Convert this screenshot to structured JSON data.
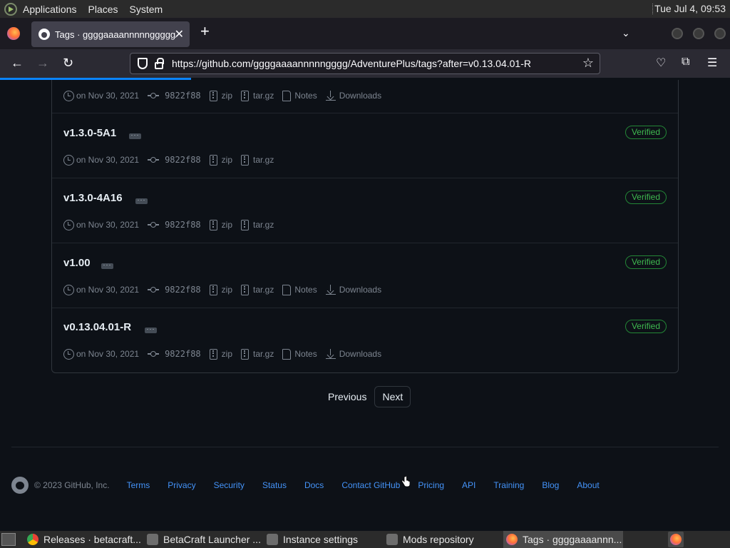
{
  "top_panel": {
    "menus": [
      "Applications",
      "Places",
      "System"
    ],
    "clock": "Tue Jul  4, 09:53"
  },
  "browser": {
    "tab_title": "Tags · ggggaaaannnnnggggg/AdventurePlus",
    "url": "https://github.com/ggggaaaannnnngggg/AdventurePlus/tags?after=v0.13.04.01-R"
  },
  "tags": [
    {
      "name": "",
      "verified": "",
      "date": "on Nov 30, 2021",
      "commit": "9822f88",
      "zip": "zip",
      "targz": "tar.gz",
      "notes": "Notes",
      "downloads": "Downloads"
    },
    {
      "name": "v1.3.0-5A1",
      "verified": "Verified",
      "date": "on Nov 30, 2021",
      "commit": "9822f88",
      "zip": "zip",
      "targz": "tar.gz",
      "notes": "",
      "downloads": ""
    },
    {
      "name": "v1.3.0-4A16",
      "verified": "Verified",
      "date": "on Nov 30, 2021",
      "commit": "9822f88",
      "zip": "zip",
      "targz": "tar.gz",
      "notes": "",
      "downloads": ""
    },
    {
      "name": "v1.00",
      "verified": "Verified",
      "date": "on Nov 30, 2021",
      "commit": "9822f88",
      "zip": "zip",
      "targz": "tar.gz",
      "notes": "Notes",
      "downloads": "Downloads"
    },
    {
      "name": "v0.13.04.01-R",
      "verified": "Verified",
      "date": "on Nov 30, 2021",
      "commit": "9822f88",
      "zip": "zip",
      "targz": "tar.gz",
      "notes": "Notes",
      "downloads": "Downloads"
    }
  ],
  "pagination": {
    "previous": "Previous",
    "next": "Next"
  },
  "footer": {
    "copyright": "© 2023 GitHub, Inc.",
    "links": [
      "Terms",
      "Privacy",
      "Security",
      "Status",
      "Docs",
      "Contact GitHub",
      "Pricing",
      "API",
      "Training",
      "Blog",
      "About"
    ]
  },
  "taskbar": {
    "items": [
      "Releases · betacraft...",
      "BetaCraft Launcher ...",
      "Instance settings",
      "Mods repository",
      "Tags · ggggaaaannn..."
    ]
  },
  "colors": {
    "page_bg": "#0d1117",
    "link": "#4493f8",
    "verified": "#3fb950",
    "accent": "#0a84ff"
  }
}
